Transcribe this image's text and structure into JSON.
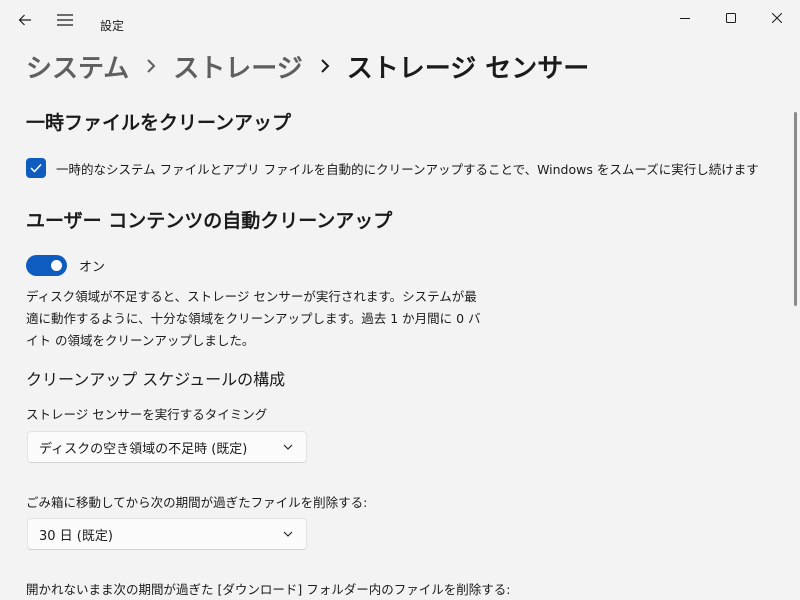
{
  "window": {
    "app_title": "設定"
  },
  "breadcrumb": {
    "items": [
      "システム",
      "ストレージ",
      "ストレージ センサー"
    ],
    "separator": "›"
  },
  "temp_files": {
    "title": "一時ファイルをクリーンアップ",
    "checkbox_label": "一時的なシステム ファイルとアプリ ファイルを自動的にクリーンアップすることで、Windows をスムーズに実行し続けます",
    "checked": true
  },
  "user_content": {
    "title": "ユーザー コンテンツの自動クリーンアップ",
    "toggle_label": "オン",
    "toggle_on": true,
    "description": "ディスク領域が不足すると、ストレージ センサーが実行されます。システムが最適に動作するように、十分な領域をクリーンアップします。過去 1 か月間に 0 バイト の領域をクリーンアップしました。"
  },
  "schedule": {
    "title": "クリーンアップ スケジュールの構成",
    "run_timing_label": "ストレージ センサーを実行するタイミング",
    "run_timing_value": "ディスクの空き領域の不足時 (既定)",
    "recycle_label": "ごみ箱に移動してから次の期間が過ぎたファイルを削除する:",
    "recycle_value": "30 日 (既定)",
    "downloads_label": "開かれないまま次の期間が過ぎた [ダウンロード] フォルダー内のファイルを削除する:"
  },
  "colors": {
    "accent": "#0f5cc0",
    "background": "#f3f3f3"
  },
  "icons": {
    "back": "back-arrow-icon",
    "menu": "hamburger-menu-icon",
    "minimize": "minimize-icon",
    "maximize": "maximize-icon",
    "close": "close-icon",
    "check": "checkmark-icon",
    "chevron": "chevron-down-icon"
  }
}
